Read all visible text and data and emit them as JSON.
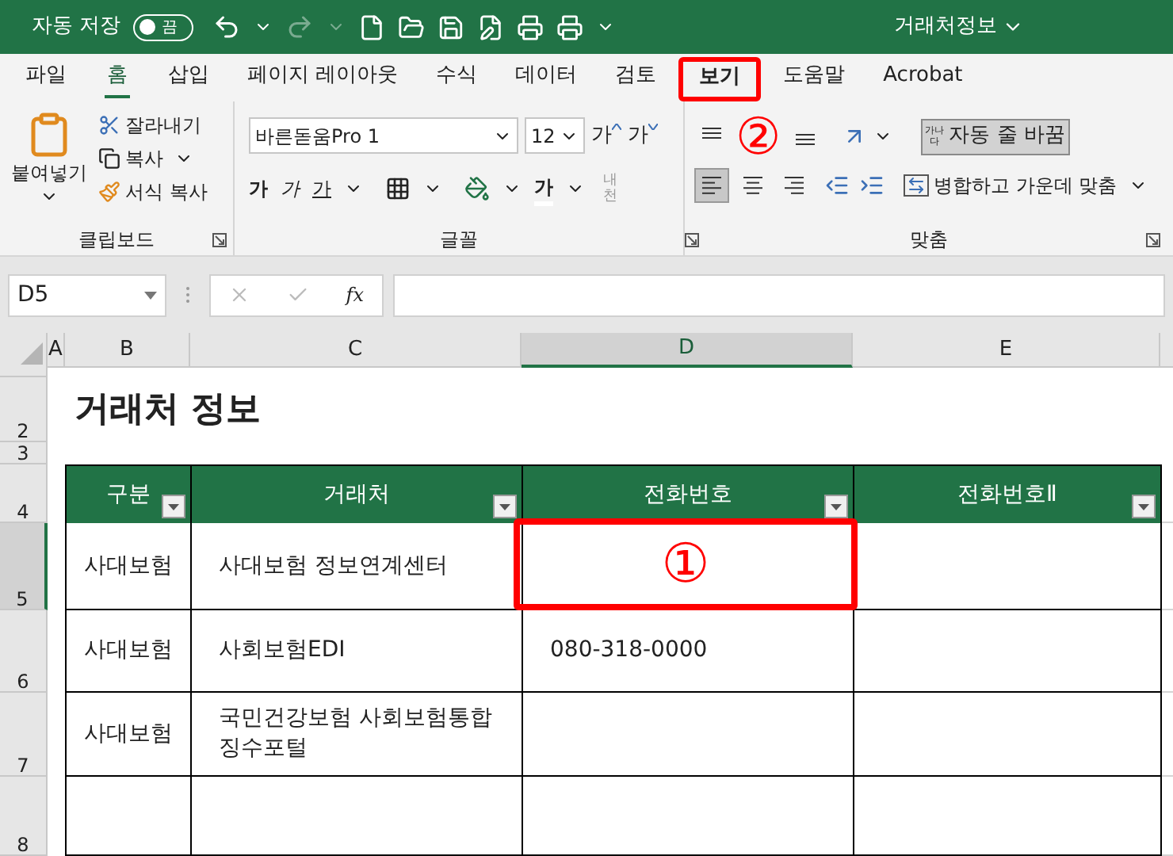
{
  "title_bar": {
    "autosave_label": "자동 저장",
    "autosave_toggle": {
      "label": "끔",
      "on": false
    },
    "document_title": "거래처정보"
  },
  "tabs": [
    {
      "label": "파일",
      "selected": false,
      "annotated": false
    },
    {
      "label": "홈",
      "selected": true,
      "annotated": false
    },
    {
      "label": "삽입",
      "selected": false,
      "annotated": false
    },
    {
      "label": "페이지 레이아웃",
      "selected": false,
      "annotated": false
    },
    {
      "label": "수식",
      "selected": false,
      "annotated": false
    },
    {
      "label": "데이터",
      "selected": false,
      "annotated": false
    },
    {
      "label": "검토",
      "selected": false,
      "annotated": false
    },
    {
      "label": "보기",
      "selected": false,
      "annotated": true
    },
    {
      "label": "도움말",
      "selected": false,
      "annotated": false
    },
    {
      "label": "Acrobat",
      "selected": false,
      "annotated": false
    }
  ],
  "ribbon": {
    "clipboard": {
      "paste": "붙여넣기",
      "cut": "잘라내기",
      "copy": "복사",
      "format_painter": "서식 복사",
      "group_label": "클립보드"
    },
    "font": {
      "font_name": "바른돋움Pro 1",
      "font_size": "12",
      "grow": "가",
      "shrink": "가",
      "bold": "가",
      "italic": "가",
      "underline": "가",
      "font_color": "가",
      "phonetic": "내천",
      "group_label": "글꼴"
    },
    "alignment": {
      "vertical": [
        {
          "kind": "top",
          "selected": false
        },
        {
          "kind": "bottom",
          "selected": false
        }
      ],
      "horizontal": [
        {
          "kind": "left",
          "selected": true
        },
        {
          "kind": "center",
          "selected": false
        },
        {
          "kind": "right",
          "selected": false
        }
      ],
      "wrap_icon": "가나다",
      "wrap_text": {
        "label": "자동 줄 바꿈",
        "selected": true
      },
      "merge": "병합하고 가운데 맞춤",
      "group_label": "맞춤"
    }
  },
  "formula_bar": {
    "name_box": "D5",
    "function_label": "fx"
  },
  "sheet": {
    "columns": [
      {
        "label": "A",
        "selected": false
      },
      {
        "label": "B",
        "selected": false
      },
      {
        "label": "C",
        "selected": false
      },
      {
        "label": "D",
        "selected": true
      },
      {
        "label": "E",
        "selected": false
      }
    ],
    "rows": [
      {
        "selected": false
      },
      {
        "label": "2",
        "selected": false
      },
      {
        "label": "3",
        "selected": false
      },
      {
        "label": "4",
        "selected": false
      },
      {
        "label": "5",
        "selected": true
      },
      {
        "label": "6",
        "selected": false
      },
      {
        "label": "7",
        "selected": false
      },
      {
        "label": "8",
        "selected": false
      }
    ],
    "title": "거래처 정보",
    "table": {
      "headers": [
        "구분",
        "거래처",
        "전화번호",
        "전화번호Ⅱ"
      ],
      "rows": [
        {
          "category": "사대보험",
          "company": "사대보험 정보연계센터"
        },
        {
          "category": "사대보험",
          "company": "사회보험EDI",
          "phone": "080-318-0000"
        },
        {
          "category": "사대보험",
          "company": "국민건강보험 사회보험통합 징수포털"
        }
      ]
    }
  },
  "annotations": [
    {
      "label": "①"
    },
    {
      "label": "②"
    }
  ]
}
